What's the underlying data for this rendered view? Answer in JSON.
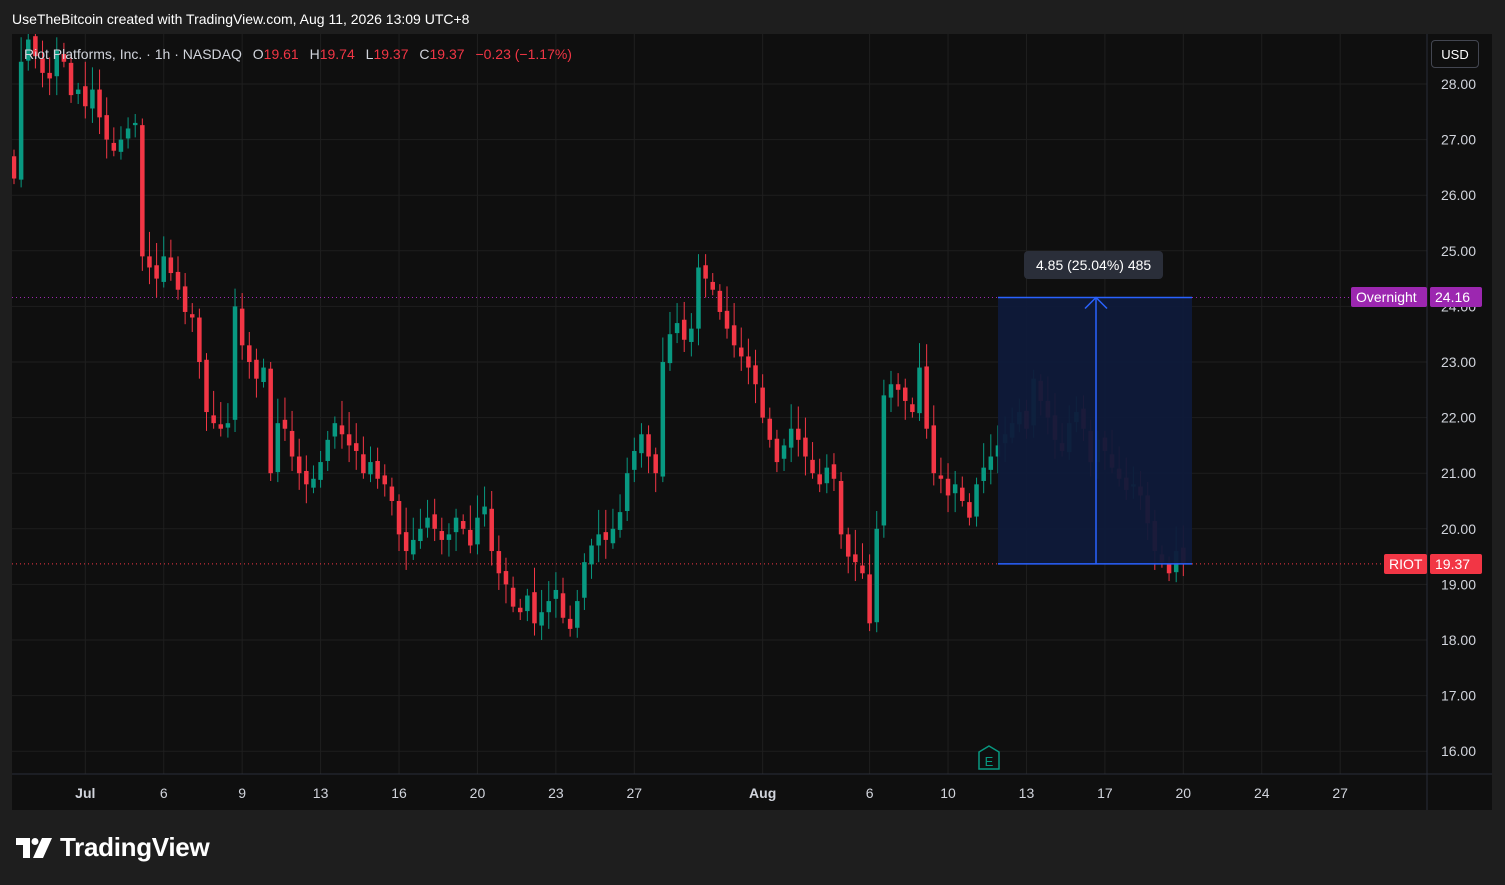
{
  "header": {
    "attribution": "UseTheBitcoin created with TradingView.com, Aug 11, 2026 13:09 UTC+8"
  },
  "legend": {
    "symbol_name": "Riot Platforms, Inc.",
    "interval": "1h",
    "exchange": "NASDAQ",
    "open_label": "O",
    "open": "19.61",
    "high_label": "H",
    "high": "19.74",
    "low_label": "L",
    "low": "19.37",
    "close_label": "C",
    "close": "19.37",
    "change": "−0.23 (−1.17%)"
  },
  "toolbar": {
    "currency": "USD"
  },
  "price_tags": {
    "overnight_label": "Overnight",
    "overnight_value": "24.16",
    "ticker_label": "RIOT",
    "last_value": "19.37"
  },
  "measure": {
    "label": "4.85 (25.04%) 485",
    "from_price": 19.37,
    "to_price": 24.16,
    "start_date": "Aug 11",
    "end_date": "Aug 20"
  },
  "events": {
    "earnings_marker": "E"
  },
  "branding": {
    "logo_text": "TradingView",
    "logo_icon": "tradingview-logo-icon"
  },
  "colors": {
    "background": "#0f0f0f",
    "up": "#089981",
    "down": "#f23645",
    "measure_line": "#2962ff",
    "measure_fill": "#0f1a3a",
    "overnight_tag": "#9c27b0",
    "last_price_tag": "#f23645",
    "grid": "#1f1f1f",
    "axis_text": "#d1d4dc"
  },
  "chart_data": {
    "type": "candlestick",
    "y_axis": {
      "ticks": [
        "16.00",
        "17.00",
        "18.00",
        "19.00",
        "20.00",
        "21.00",
        "22.00",
        "23.00",
        "24.00",
        "25.00",
        "26.00",
        "27.00",
        "28.00"
      ],
      "range": [
        15.6,
        28.9
      ],
      "position": "right"
    },
    "x_axis": {
      "ticks": [
        {
          "label": "Jul",
          "bold": true,
          "i": 10
        },
        {
          "label": "6",
          "i": 21
        },
        {
          "label": "9",
          "i": 32
        },
        {
          "label": "13",
          "i": 43
        },
        {
          "label": "16",
          "i": 54
        },
        {
          "label": "20",
          "i": 65
        },
        {
          "label": "23",
          "i": 76
        },
        {
          "label": "27",
          "i": 87
        },
        {
          "label": "Aug",
          "bold": true,
          "i": 105
        },
        {
          "label": "6",
          "i": 120
        },
        {
          "label": "10",
          "i": 131
        },
        {
          "label": "13",
          "i": 142
        },
        {
          "label": "17",
          "i": 153
        },
        {
          "label": "20",
          "i": 164
        },
        {
          "label": "24",
          "i": 175
        },
        {
          "label": "27",
          "i": 186
        }
      ]
    },
    "price_levels": {
      "overnight": 24.16,
      "last": 19.37
    },
    "grid": true,
    "closes": [
      26.3,
      28.4,
      28.8,
      28.5,
      28.2,
      28.1,
      28.6,
      28.4,
      27.8,
      27.9,
      27.6,
      27.9,
      27.4,
      27.0,
      26.8,
      27.0,
      27.2,
      27.3,
      24.9,
      24.7,
      24.5,
      24.9,
      24.6,
      24.3,
      23.9,
      23.8,
      23.0,
      22.1,
      21.9,
      21.8,
      21.9,
      24.0,
      23.3,
      23.0,
      22.7,
      22.9,
      21.0,
      21.9,
      21.8,
      21.3,
      21.0,
      20.8,
      20.9,
      21.2,
      21.6,
      21.9,
      21.7,
      21.5,
      21.4,
      21.0,
      21.2,
      20.9,
      20.8,
      20.5,
      19.9,
      19.6,
      19.8,
      20.0,
      20.2,
      20.0,
      19.8,
      19.9,
      20.2,
      20.0,
      19.7,
      20.2,
      20.4,
      19.6,
      19.2,
      19.0,
      18.6,
      18.5,
      18.8,
      18.3,
      18.5,
      18.7,
      18.9,
      18.4,
      18.2,
      18.7,
      19.4,
      19.7,
      19.9,
      19.8,
      20.0,
      20.3,
      21.0,
      21.4,
      21.7,
      21.3,
      21.0,
      23.0,
      23.5,
      23.7,
      23.4,
      23.6,
      24.7,
      24.5,
      24.3,
      23.9,
      23.6,
      23.3,
      23.1,
      22.9,
      22.6,
      22.0,
      21.6,
      21.2,
      21.5,
      21.8,
      21.6,
      21.3,
      21.0,
      20.8,
      21.1,
      20.9,
      19.9,
      19.5,
      19.4,
      19.2,
      18.3,
      20.0,
      22.4,
      22.6,
      22.5,
      22.3,
      22.1,
      22.9,
      21.8,
      21.0,
      20.9,
      20.6,
      20.8,
      20.5,
      20.2,
      20.8,
      21.1,
      21.3,
      21.5,
      21.7,
      21.9,
      22.1,
      21.8,
      22.7,
      22.3,
      22.0,
      21.6,
      21.4,
      21.9,
      22.1,
      21.8,
      21.2,
      21.6,
      21.4,
      21.1,
      20.9,
      20.7,
      20.8,
      20.6,
      20.1,
      19.6,
      19.4,
      19.2,
      19.6,
      19.37
    ]
  }
}
